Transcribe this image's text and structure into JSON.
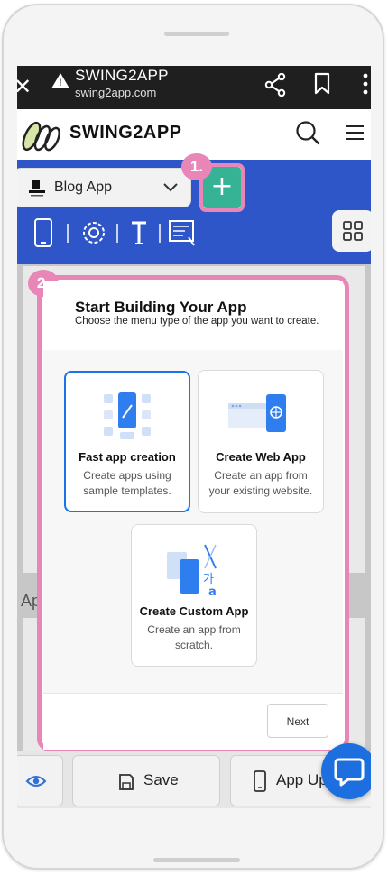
{
  "browser": {
    "site_title": "SWING2APP",
    "url": "swing2app.com"
  },
  "header": {
    "brand": "SWING2APP"
  },
  "toolbar": {
    "app_badge_text": "BLOG APP",
    "app_name": "Blog App",
    "add_label": "+",
    "callout_1": "1.",
    "callout_2": "2."
  },
  "editor": {
    "partial_label": "Ap"
  },
  "modal": {
    "title": "Start Building Your App",
    "subtitle": "Choose the menu type of the app you want to create.",
    "cards": [
      {
        "title": "Fast app creation",
        "desc": "Create apps using sample templates.",
        "selected": true
      },
      {
        "title": "Create Web App",
        "desc": "Create an app from your existing website.",
        "selected": false
      },
      {
        "title": "Create Custom App",
        "desc": "Create an app from scratch.",
        "selected": false
      }
    ],
    "custom_glyph": "가",
    "custom_glyph_2": "a",
    "next_label": "Next"
  },
  "bottom": {
    "save_label": "Save",
    "app_update_label": "App Up"
  },
  "colors": {
    "primary_blue": "#2e56c8",
    "highlight_pink": "#e986b8",
    "add_green": "#36b394",
    "select_blue": "#1a73e8",
    "chat_blue": "#1d6fe0"
  },
  "icons": [
    "close-icon",
    "warning-icon",
    "share-icon",
    "bookmark-icon",
    "more-icon",
    "search-icon",
    "hamburger-menu-icon",
    "chevron-down-icon",
    "plus-icon",
    "phone-icon",
    "gear-icon",
    "text-icon",
    "list-icon",
    "grid-icon",
    "eye-icon",
    "save-icon",
    "mobile-icon",
    "chat-icon"
  ]
}
